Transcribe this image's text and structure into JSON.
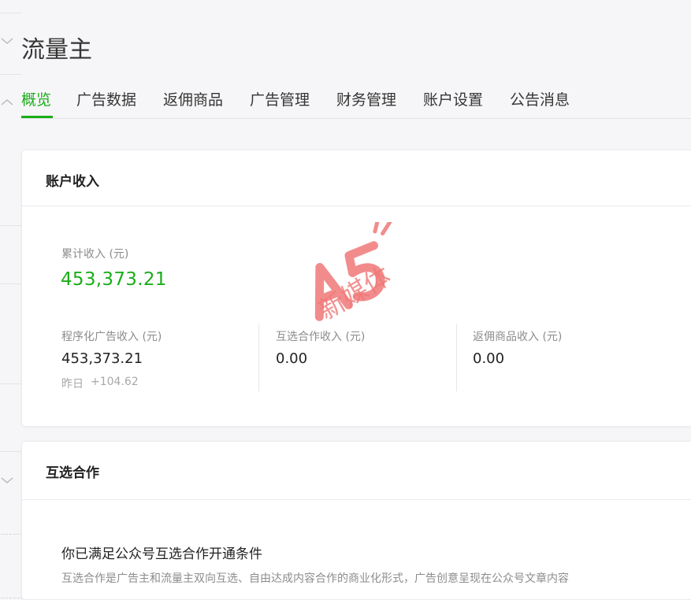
{
  "header": {
    "title": "流量主"
  },
  "tabs": [
    {
      "label": "概览",
      "active": true
    },
    {
      "label": "广告数据",
      "active": false
    },
    {
      "label": "返佣商品",
      "active": false
    },
    {
      "label": "广告管理",
      "active": false
    },
    {
      "label": "财务管理",
      "active": false
    },
    {
      "label": "账户设置",
      "active": false
    },
    {
      "label": "公告消息",
      "active": false
    }
  ],
  "income": {
    "title": "账户收入",
    "total_label": "累计收入 (元)",
    "total_value": "453,373.21",
    "programmatic_label": "程序化广告收入 (元)",
    "programmatic_value": "453,373.21",
    "yesterday_label": "昨日",
    "yesterday_value": "+104.62",
    "mutual_label": "互选合作收入 (元)",
    "mutual_value": "0.00",
    "rebate_label": "返佣商品收入 (元)",
    "rebate_value": "0.00"
  },
  "mutual": {
    "title": "互选合作",
    "heading": "你已满足公众号互选合作开通条件",
    "description": "互选合作是广告主和流量主双向互选、自由达成内容合作的商业化形式，广告创意呈现在公众号文章内容"
  },
  "watermark": {
    "text": "新媒体"
  },
  "colors": {
    "accent": "#1aad19",
    "watermark": "#f07878"
  },
  "icons": {
    "rail_top": "chevron-down-icon",
    "rail_mid": "chevron-up-icon",
    "rail_bottom": "chevron-down-icon"
  }
}
